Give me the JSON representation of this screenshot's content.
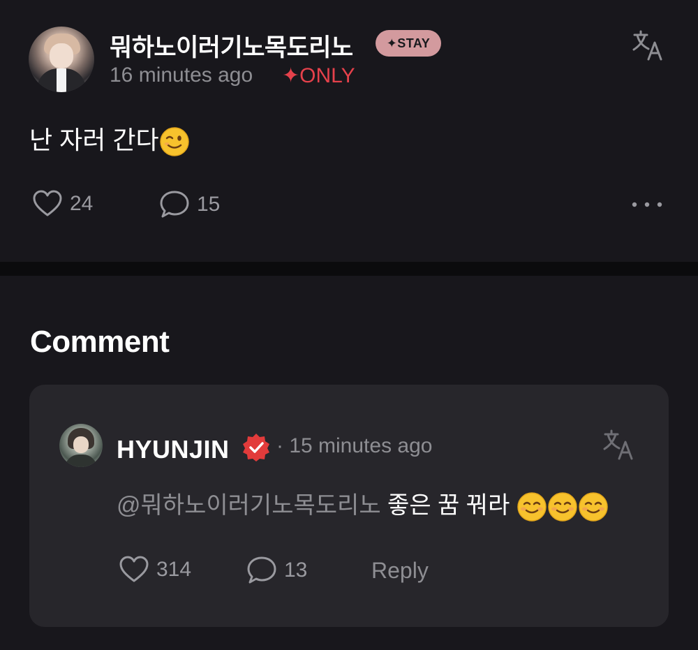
{
  "post": {
    "author": {
      "name": "뭐하노이러기노목도리노",
      "badge": "✦STAY"
    },
    "time": "16 minutes ago",
    "visibility": "✦ONLY",
    "body_text": "난 자러 간다",
    "body_emoji": "winking-face-emoji",
    "likes": "24",
    "comments": "15",
    "icons": {
      "translate": "translate-icon",
      "like": "heart-icon",
      "comment": "speech-bubble-icon",
      "more": "more-dots-icon"
    }
  },
  "comments_section": {
    "heading": "Comment",
    "items": [
      {
        "author": "HYUNJIN",
        "verified": true,
        "time": "· 15 minutes ago",
        "mention": "@뭐하노이러기노목도리노",
        "text": " 좋은 꿈 꿔라",
        "emoji": [
          "smiling-face-emoji",
          "smiling-face-emoji",
          "smiling-face-emoji"
        ],
        "likes": "314",
        "replies": "13",
        "reply_label": "Reply"
      }
    ]
  },
  "colors": {
    "background": "#18171c",
    "card": "#27262b",
    "muted_text": "#8e8e93",
    "accent_red": "#e5414b",
    "stay_badge": "#d39a9e"
  }
}
